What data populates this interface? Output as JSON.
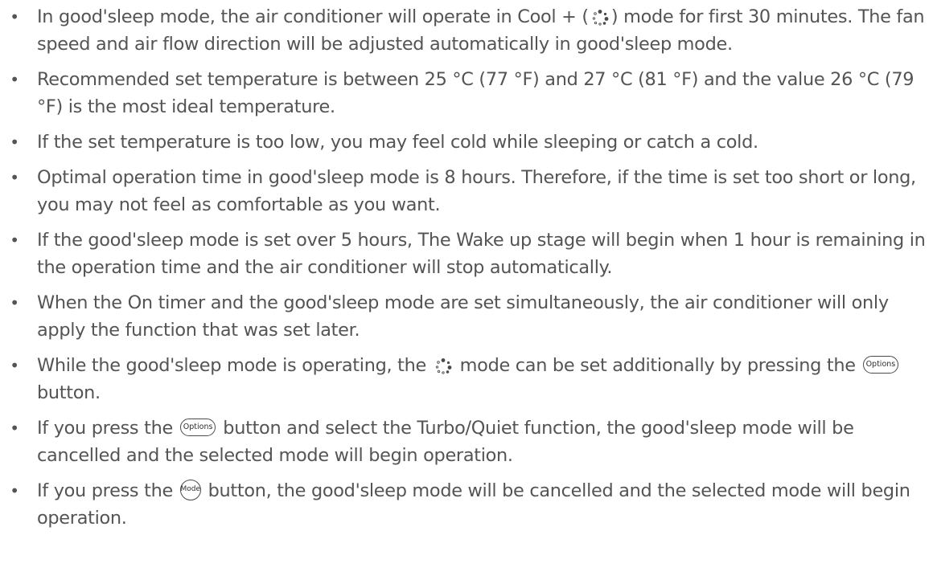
{
  "notes": {
    "n1": {
      "a": "In good'sleep mode, the air conditioner will operate in Cool + (",
      "b": ") mode for first 30 minutes. The fan speed and air flow direction will be adjusted automatically in good'sleep mode."
    },
    "n2": "Recommended set temperature is between 25 °C (77 °F) and 27 °C (81 °F) and the value 26 °C (79 °F) is the most ideal temperature.",
    "n3": "If the set temperature is too low, you may feel cold while sleeping or catch a cold.",
    "n4": "Optimal operation time in good'sleep mode is 8 hours. Therefore, if the time is set too short or long, you may not feel as comfortable as you want.",
    "n5": "If the good'sleep mode is set over 5 hours, The Wake up stage will begin when 1 hour is remaining in the operation time and the air conditioner will stop automatically.",
    "n6": "When the On timer and the good'sleep mode are set simultaneously, the air conditioner will only apply the function that was set later.",
    "n7": {
      "a": "While the good'sleep mode is operating, the",
      "b": "mode can be set additionally by pressing the",
      "c": "button."
    },
    "n8": {
      "a": "If you press the",
      "b": "button and select the Turbo/Quiet function, the good'sleep mode will be cancelled and the selected mode will begin operation."
    },
    "n9": {
      "a": "If you press the",
      "b": "button, the good'sleep mode will be cancelled and the selected mode will begin operation."
    }
  },
  "bullet_char": "•",
  "buttons": {
    "options": "Options",
    "mode": "Mode"
  },
  "icons": {
    "sleep_mode": "good-sleep-dots-icon"
  },
  "colors": {
    "text": "#545454",
    "icon": "#4a4a4a"
  }
}
